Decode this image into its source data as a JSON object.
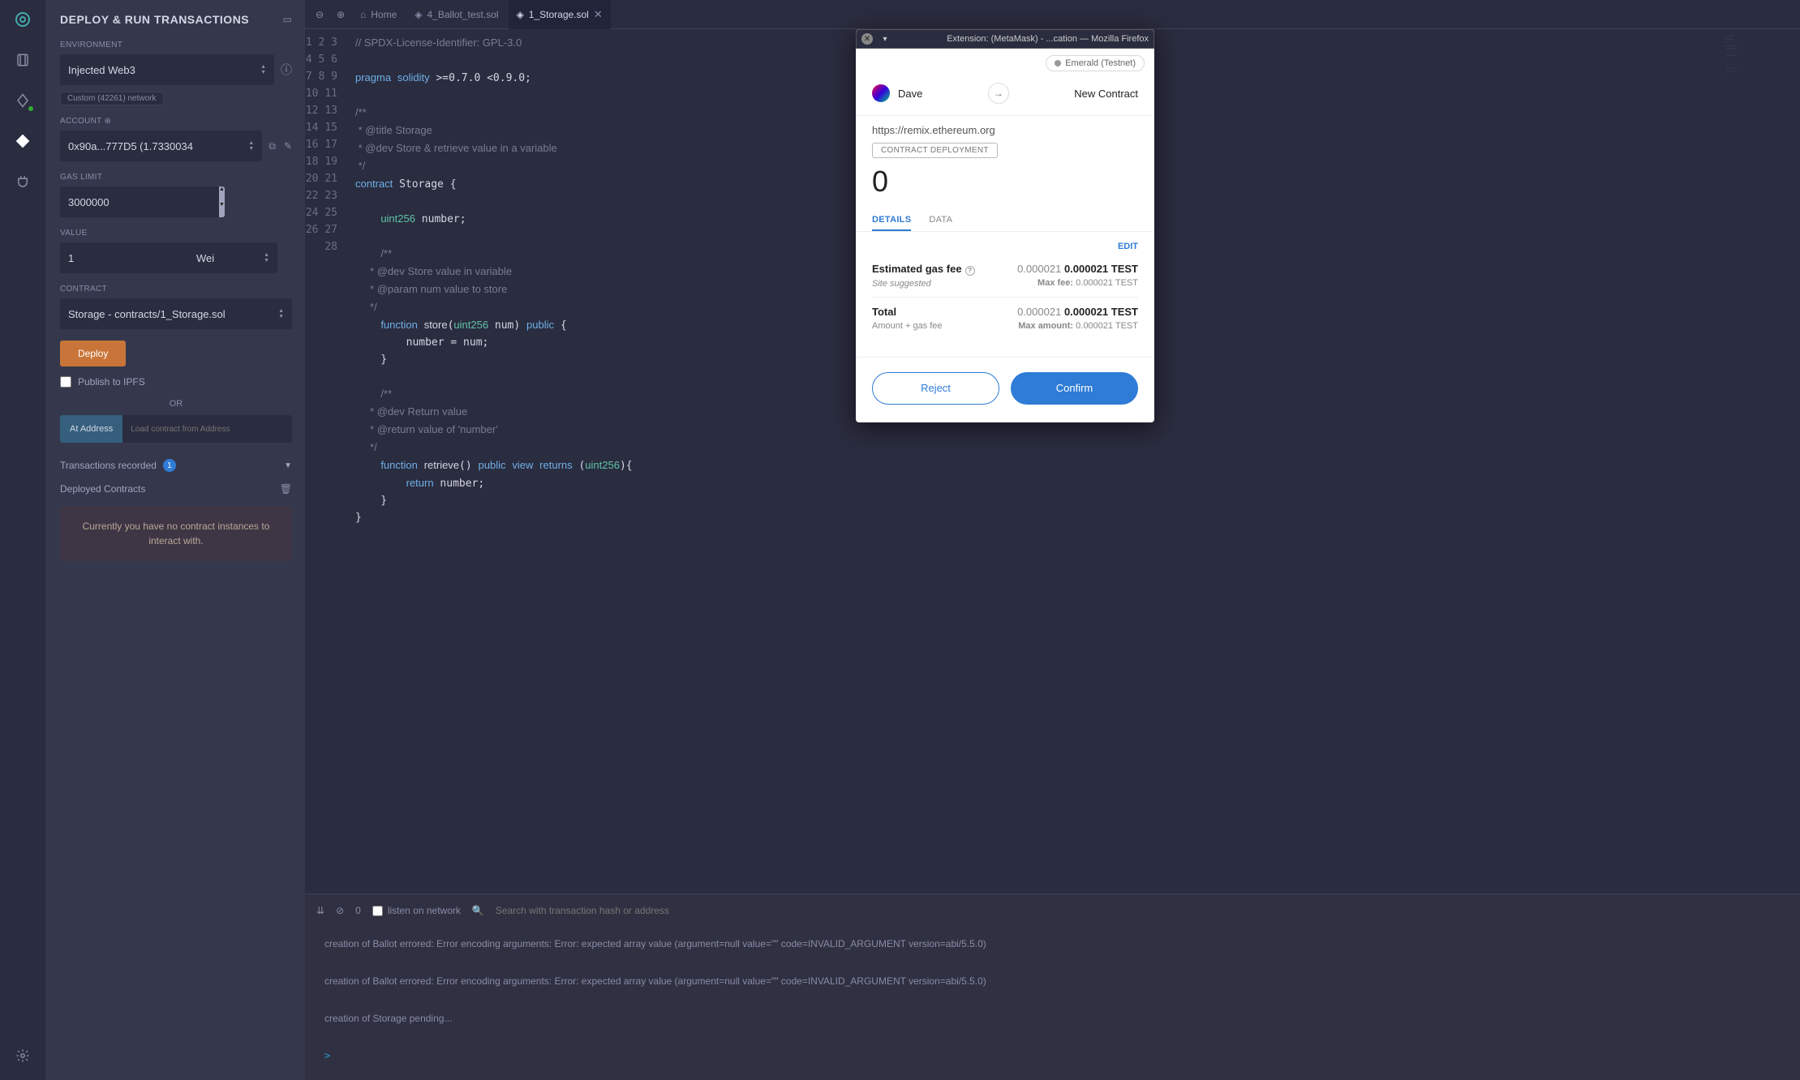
{
  "side": {
    "title": "DEPLOY & RUN TRANSACTIONS",
    "env_label": "ENVIRONMENT",
    "env_value": "Injected Web3",
    "network_badge": "Custom (42261) network",
    "account_label": "ACCOUNT",
    "account_value": "0x90a...777D5 (1.7330034",
    "gas_label": "GAS LIMIT",
    "gas_value": "3000000",
    "value_label": "VALUE",
    "value_value": "1",
    "unit_value": "Wei",
    "contract_label": "CONTRACT",
    "contract_value": "Storage - contracts/1_Storage.sol",
    "deploy_btn": "Deploy",
    "publish_ipfs": "Publish to IPFS",
    "or": "OR",
    "at_address_btn": "At Address",
    "at_address_ph": "Load contract from Address",
    "tx_recorded": "Transactions recorded",
    "tx_count": "1",
    "deployed": "Deployed Contracts",
    "empty": "Currently you have no contract instances to interact with."
  },
  "tabs": {
    "home": "Home",
    "t1": "4_Ballot_test.sol",
    "t2": "1_Storage.sol"
  },
  "terminal": {
    "listen": "listen on network",
    "search_ph": "Search with transaction hash or address",
    "pending_count": "0",
    "lines": [
      "creation of Ballot errored: Error encoding arguments: Error: expected array value (argument=null value=\"\" code=INVALID_ARGUMENT version=abi/5.5.0)",
      "creation of Ballot errored: Error encoding arguments: Error: expected array value (argument=null value=\"\" code=INVALID_ARGUMENT version=abi/5.5.0)",
      "creation of Storage pending..."
    ],
    "prompt": ">"
  },
  "mm": {
    "titlebar": "Extension: (MetaMask) - ...cation — Mozilla Firefox",
    "network": "Emerald (Testnet)",
    "from": "Dave",
    "to": "New Contract",
    "site": "https://remix.ethereum.org",
    "badge": "CONTRACT DEPLOYMENT",
    "amount": "0",
    "tab_details": "DETAILS",
    "tab_data": "DATA",
    "edit": "EDIT",
    "gas_label": "Estimated gas fee",
    "gas_sub": "Site suggested",
    "gas_dim": "0.000021",
    "gas_bold": "0.000021 TEST",
    "gas_max_label": "Max fee:",
    "gas_max_val": "0.000021 TEST",
    "total_label": "Total",
    "total_sub": "Amount + gas fee",
    "total_dim": "0.000021",
    "total_bold": "0.000021 TEST",
    "total_max_label": "Max amount:",
    "total_max_val": "0.000021 TEST",
    "reject": "Reject",
    "confirm": "Confirm"
  }
}
